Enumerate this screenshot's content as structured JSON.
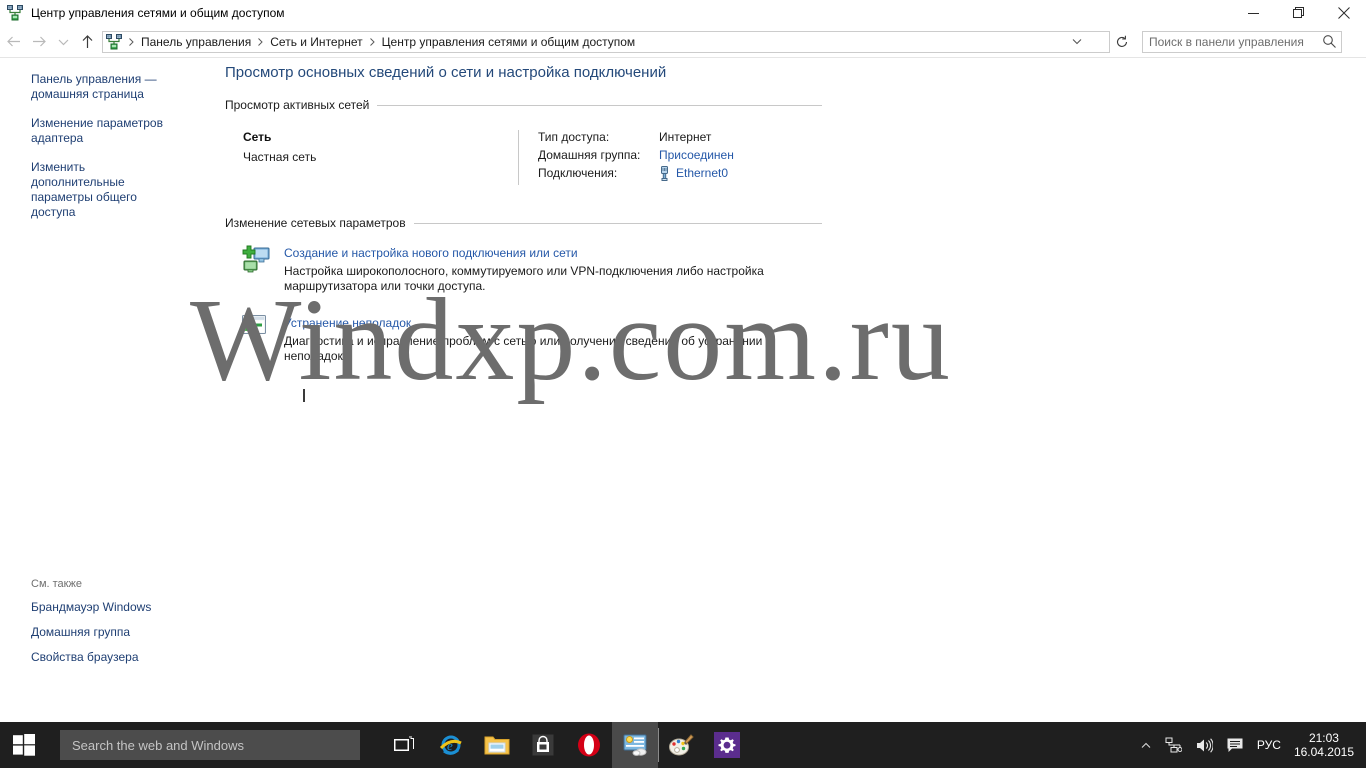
{
  "window": {
    "title": "Центр управления сетями и общим доступом",
    "icon": "network-sharing-icon",
    "minimize_label": "—",
    "maximize_label": "❐",
    "close_label": "✕"
  },
  "addressbar": {
    "back_icon": "back-arrow-icon",
    "forward_icon": "forward-arrow-icon",
    "history_icon": "chevron-down-icon",
    "up_icon": "up-arrow-icon",
    "breadcrumbs": [
      "Панель управления",
      "Сеть и Интернет",
      "Центр управления сетями и общим доступом"
    ],
    "dropdown_icon": "chevron-down-icon",
    "refresh_icon": "refresh-icon",
    "search_placeholder": "Поиск в панели управления",
    "search_value": "",
    "search_icon": "search-icon"
  },
  "sidebar": {
    "links": [
      "Панель управления — домашняя страница",
      "Изменение параметров адаптера",
      "Изменить дополнительные параметры общего доступа"
    ],
    "see_also_title": "См. также",
    "see_also": [
      "Брандмауэр Windows",
      "Домашняя группа",
      "Свойства браузера"
    ]
  },
  "main": {
    "page_title": "Просмотр основных сведений о сети и настройка подключений",
    "active_networks_heading": "Просмотр активных сетей",
    "network": {
      "name": "Сеть",
      "type": "Частная сеть",
      "rows": [
        {
          "label": "Тип доступа:",
          "value": "Интернет",
          "link": false
        },
        {
          "label": "Домашняя группа:",
          "value": "Присоединен",
          "link": true
        },
        {
          "label": "Подключения:",
          "value": "Ethernet0",
          "link": true,
          "icon": "ethernet-adapter-icon"
        }
      ]
    },
    "settings_heading": "Изменение сетевых параметров",
    "tasks": [
      {
        "icon": "new-connection-icon",
        "link": "Создание и настройка нового подключения или сети",
        "description": "Настройка широкополосного, коммутируемого или VPN-подключения либо настройка маршрутизатора или точки доступа."
      },
      {
        "icon": "troubleshoot-icon",
        "link": "Устранение неполадок",
        "description": "Диагностика и исправление проблем с сетью или получение сведений об устранении неполадок."
      }
    ]
  },
  "watermark": "Windxp.com.ru",
  "taskbar": {
    "start_icon": "windows-logo-icon",
    "search_placeholder": "Search the web and Windows",
    "buttons": [
      {
        "name": "task-view-button",
        "icon": "task-view-icon",
        "active": false
      },
      {
        "name": "internet-explorer-button",
        "icon": "internet-explorer-icon",
        "active": false
      },
      {
        "name": "file-explorer-button",
        "icon": "file-explorer-icon",
        "active": false
      },
      {
        "name": "store-button",
        "icon": "store-icon",
        "active": false
      },
      {
        "name": "opera-button",
        "icon": "opera-icon",
        "active": false
      },
      {
        "name": "control-panel-button",
        "icon": "network-sharing-icon",
        "active": true
      },
      {
        "name": "paint-button",
        "icon": "paint-icon",
        "active": false
      },
      {
        "name": "settings-button",
        "icon": "gear-icon",
        "active": false
      }
    ],
    "tray": {
      "overflow_icon": "show-hidden-icons-icon",
      "network_icon": "network-icon",
      "volume_icon": "speaker-icon",
      "action_center_icon": "action-center-icon",
      "language": "РУС",
      "time": "21:03",
      "date": "16.04.2015"
    }
  },
  "colors": {
    "link": "#2558a8",
    "nav_link": "#1f3f73",
    "title": "#24497a",
    "taskbar": "#1f1f1f",
    "taskbar_search": "#4c4c4c"
  }
}
